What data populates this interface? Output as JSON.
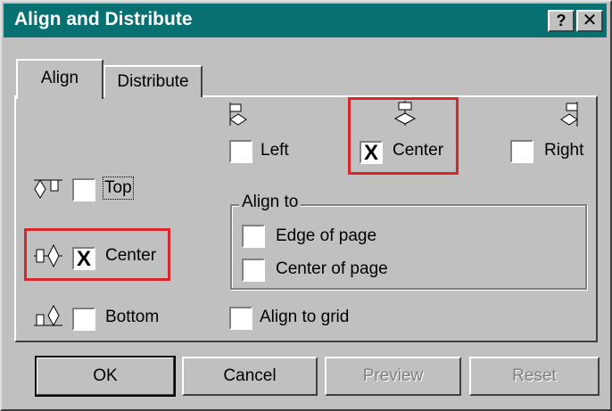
{
  "window": {
    "title": "Align and Distribute"
  },
  "titlebar": {
    "help_label": "?",
    "close_label": "✕"
  },
  "tabs": [
    {
      "label": "Align"
    },
    {
      "label": "Distribute"
    }
  ],
  "horizontal": {
    "left": {
      "label": "Left",
      "checked": false,
      "mark": ""
    },
    "center": {
      "label": "Center",
      "checked": true,
      "mark": "X"
    },
    "right": {
      "label": "Right",
      "checked": false,
      "mark": ""
    }
  },
  "vertical": {
    "top": {
      "label": "Top",
      "checked": false,
      "mark": ""
    },
    "center": {
      "label": "Center",
      "checked": true,
      "mark": "X"
    },
    "bottom": {
      "label": "Bottom",
      "checked": false,
      "mark": ""
    }
  },
  "align_to": {
    "title": "Align to",
    "edge": {
      "label": "Edge of page",
      "checked": false,
      "mark": ""
    },
    "center": {
      "label": "Center of page",
      "checked": false,
      "mark": ""
    }
  },
  "align_grid": {
    "label": "Align to grid",
    "checked": false,
    "mark": ""
  },
  "buttons": {
    "ok": "OK",
    "cancel": "Cancel",
    "preview": "Preview",
    "reset": "Reset"
  },
  "colors": {
    "titlebar": "#087071",
    "face": "#c0c0c0",
    "highlight": "#d8262a"
  },
  "icons": [
    "align-left-icon",
    "align-center-h-icon",
    "align-right-icon",
    "align-top-icon",
    "align-center-v-icon",
    "align-bottom-icon"
  ]
}
